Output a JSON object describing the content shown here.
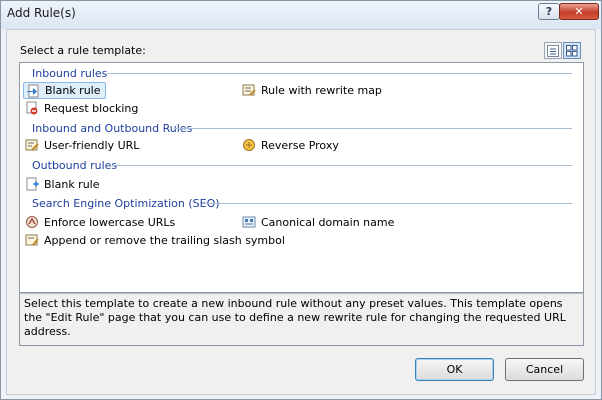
{
  "window": {
    "title": "Add Rule(s)",
    "help_label": "?",
    "close_label": "✕"
  },
  "prompt": "Select a rule template:",
  "view_buttons": {
    "details": "details-view-icon",
    "tiles": "tiles-view-icon",
    "active": "tiles"
  },
  "groups": {
    "inbound": {
      "title": "Inbound rules",
      "items": [
        {
          "label": "Blank rule",
          "icon": "blank-rule-arrow-icon"
        },
        {
          "label": "Rule with rewrite map",
          "icon": "rewrite-map-icon"
        },
        {
          "label": "Request blocking",
          "icon": "request-blocking-icon"
        }
      ]
    },
    "inbound_outbound": {
      "title": "Inbound and Outbound Rules",
      "items": [
        {
          "label": "User-friendly URL",
          "icon": "user-friendly-url-icon"
        },
        {
          "label": "Reverse Proxy",
          "icon": "reverse-proxy-icon"
        }
      ]
    },
    "outbound": {
      "title": "Outbound rules",
      "items": [
        {
          "label": "Blank rule",
          "icon": "outbound-blank-rule-icon"
        }
      ]
    },
    "seo": {
      "title": "Search Engine Optimization (SEO)",
      "items": [
        {
          "label": "Enforce lowercase URLs",
          "icon": "lowercase-url-icon"
        },
        {
          "label": "Canonical domain name",
          "icon": "canonical-domain-icon"
        },
        {
          "label": "Append or remove the trailing slash symbol",
          "icon": "trailing-slash-icon"
        }
      ]
    }
  },
  "selected_item": "Blank rule",
  "description": "Select this template to create a new inbound rule without any preset values. This template opens the \"Edit Rule\" page that you can use to define a new rewrite rule for changing the requested URL address.",
  "buttons": {
    "ok": "OK",
    "cancel": "Cancel"
  },
  "colors": {
    "group_header": "#1e3f9c",
    "selection_bg": "#dfeefb",
    "selection_border": "#8fb7e3",
    "close_button": "#c4412c"
  }
}
